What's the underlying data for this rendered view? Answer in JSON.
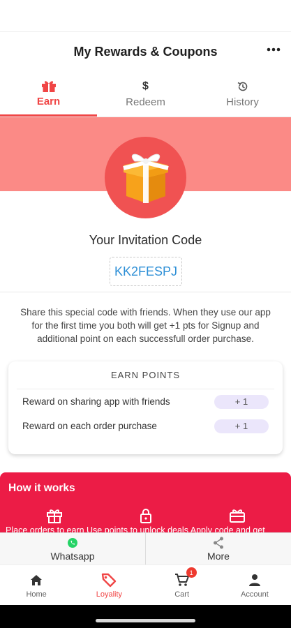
{
  "header": {
    "title": "My Rewards & Coupons",
    "more_icon": "more-horizontal-icon"
  },
  "tabs": [
    {
      "label": "Earn",
      "icon": "gift-icon",
      "active": true
    },
    {
      "label": "Redeem",
      "icon": "dollar-icon",
      "active": false
    },
    {
      "label": "History",
      "icon": "history-icon",
      "active": false
    }
  ],
  "invite": {
    "title": "Your Invitation Code",
    "code": "KK2FESPJ"
  },
  "share_text": "Share this special code with friends. When they use our app for the first time you both will get +1 pts for Signup and additional point on each successfull order purchase.",
  "earn_points": {
    "title": "EARN POINTS",
    "rows": [
      {
        "label": "Reward on sharing app with friends",
        "points": "+ 1"
      },
      {
        "label": "Reward on each order purchase",
        "points": "+ 1"
      }
    ]
  },
  "how_it_works": {
    "title": "How it works",
    "steps_text": "Place orders to earn Use points to unlock deals Apply code and get"
  },
  "share_bar": {
    "whatsapp_label": "Whatsapp",
    "more_label": "More"
  },
  "bottom_nav": [
    {
      "label": "Home",
      "icon": "home-icon"
    },
    {
      "label": "Loyality",
      "icon": "tag-icon",
      "active": true
    },
    {
      "label": "Cart",
      "icon": "cart-icon",
      "badge": "1"
    },
    {
      "label": "Account",
      "icon": "account-icon"
    }
  ],
  "colors": {
    "accent": "#f04545",
    "hero_band": "#fb8a86",
    "how_bg": "#ec1c46",
    "code_text": "#2d8fd6"
  }
}
